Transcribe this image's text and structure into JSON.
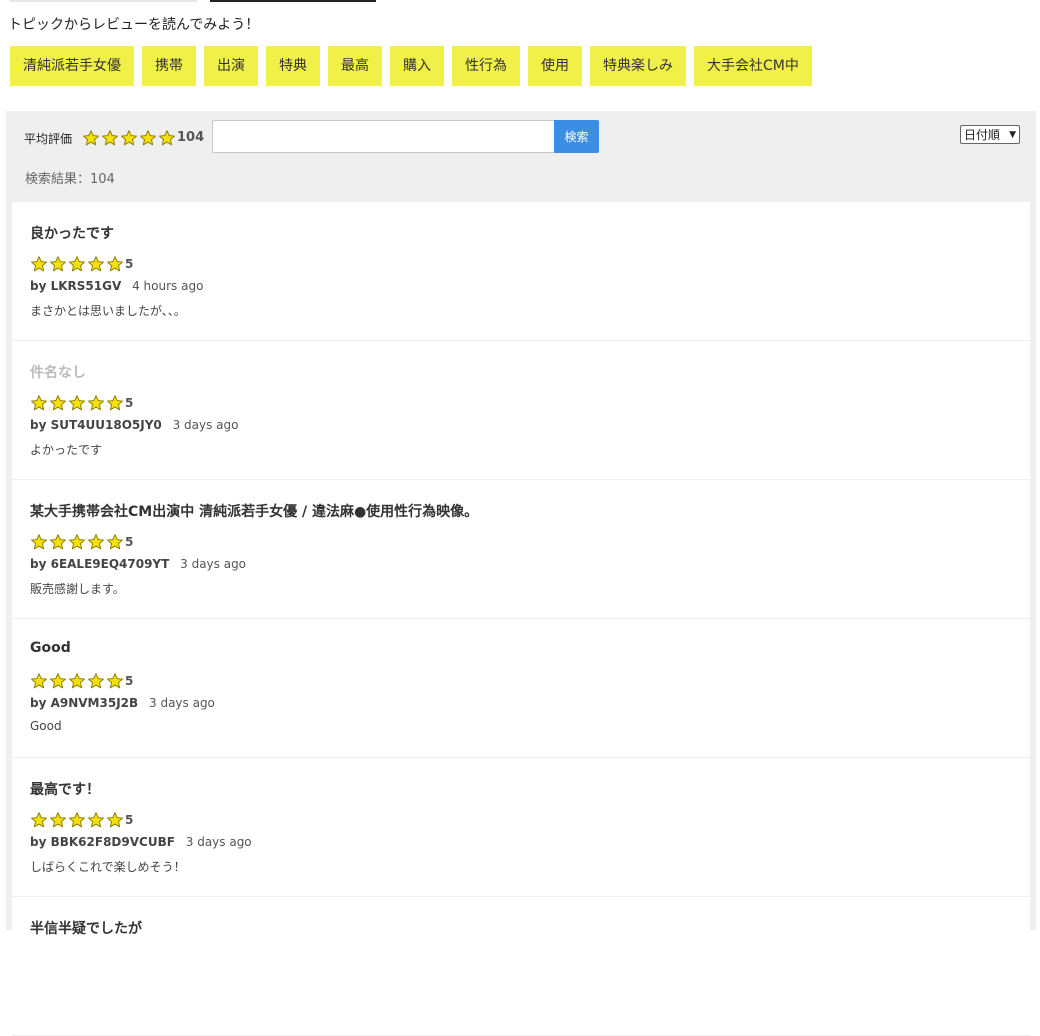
{
  "topics": {
    "heading": "トピックからレビューを読んでみよう！",
    "items": [
      "清純派若手女優",
      "携帯",
      "出演",
      "特典",
      "最高",
      "購入",
      "性行為",
      "使用",
      "特典楽しみ",
      "大手会社CM中"
    ]
  },
  "summary": {
    "avg_label": "平均評価",
    "avg_rating": 5,
    "count": "104"
  },
  "search": {
    "placeholder": "",
    "value": "",
    "button_label": "検索"
  },
  "sort": {
    "selected": "日付順"
  },
  "result_count": "検索結果：104",
  "colors": {
    "star": "#f5e00a",
    "star_stroke": "#8a7d00",
    "chip": "#f0f048",
    "button": "#3b8ee3"
  },
  "reviews": [
    {
      "title": "良かったです",
      "title_muted": false,
      "rating": "5",
      "author": "by LKRS51GV",
      "time": "4 hours ago",
      "body": "まさかとは思いましたが、、。"
    },
    {
      "title": "件名なし",
      "title_muted": true,
      "rating": "5",
      "author": "by SUT4UU18O5JY0",
      "time": "3 days ago",
      "body": "よかったです"
    },
    {
      "title": "某大手携帯会社CM出演中 清純派若手女優 / 違法麻●使用性行為映像。",
      "title_muted": false,
      "rating": "5",
      "author": "by 6EALE9EQ4709YT",
      "time": "3 days ago",
      "body": "販売感謝します。"
    },
    {
      "title": "Good",
      "title_muted": false,
      "rating": "5",
      "author": "by A9NVM35J2B",
      "time": "3 days ago",
      "body": "Good"
    },
    {
      "title": "最高です！",
      "title_muted": false,
      "rating": "5",
      "author": "by BBK62F8D9VCUBF",
      "time": "3 days ago",
      "body": "しばらくこれで楽しめそう！"
    },
    {
      "title": "半信半疑でしたが",
      "title_muted": false,
      "rating": "",
      "author": "",
      "time": "",
      "body": ""
    }
  ]
}
